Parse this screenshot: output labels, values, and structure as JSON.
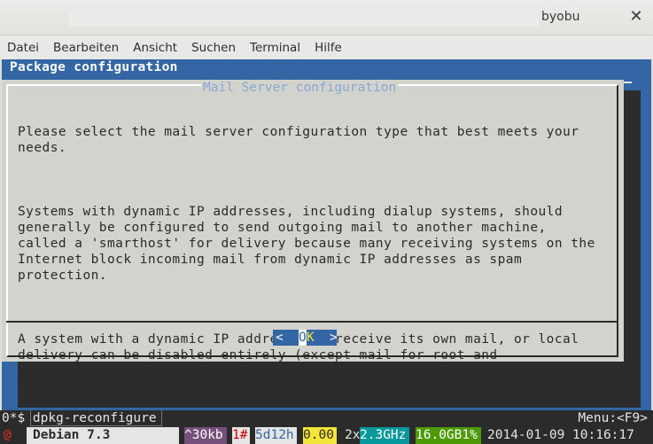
{
  "window": {
    "title": "byobu",
    "close_glyph": "✕"
  },
  "menubar": {
    "items": [
      "Datei",
      "Bearbeiten",
      "Ansicht",
      "Suchen",
      "Terminal",
      "Hilfe"
    ]
  },
  "terminal": {
    "header": "Package configuration",
    "dialog": {
      "title": "Mail Server configuration",
      "paragraphs": [
        "Please select the mail server configuration type that best meets your\nneeds.",
        "Systems with dynamic IP addresses, including dialup systems, should\ngenerally be configured to send outgoing mail to another machine,\ncalled a 'smarthost' for delivery because many receiving systems on the\nInternet block incoming mail from dynamic IP addresses as spam\nprotection.",
        "A system with a dynamic IP address can receive its own mail, or local\ndelivery can be disabled entirely (except mail for root and\npostmaster)."
      ],
      "button": {
        "left": "<",
        "o": "O",
        "k": "K",
        "right": ">"
      }
    }
  },
  "cmdline": {
    "text": "0*$ dpkg-reconfigure",
    "menu_hint": "Menu:<F9>"
  },
  "statusbar": {
    "logo": "@",
    "os": "Debian 7.3",
    "traffic": "^30kb",
    "window_count": "1#",
    "uptime": "5d12h",
    "load": "0.00",
    "cpu_count": "2x",
    "cpu_freq": "2.3GHz",
    "mem": "16.0GB1%",
    "datetime": "2014-01-09 10:16:17"
  },
  "colors": {
    "terminal_bg": "#3465a4",
    "dialog_bg": "#d3d3ce",
    "status_purple": "#75507b",
    "status_yellow": "#f4e53a",
    "status_teal": "#06989a",
    "status_green": "#4e9a06",
    "status_red": "#cc0000"
  }
}
